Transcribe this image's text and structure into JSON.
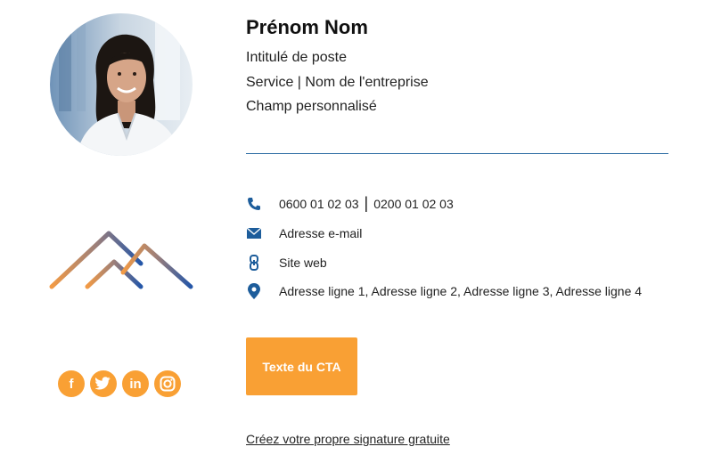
{
  "profile": {
    "name": "Prénom Nom",
    "job_title": "Intitulé de poste",
    "department_company": "Service | Nom de l'entreprise",
    "custom_field": "Champ personnalisé"
  },
  "contacts": {
    "phone_mobile": "0600 01 02 03",
    "phone_separator": "|",
    "phone_landline": "0200 01 02 03",
    "email": "Adresse e-mail",
    "website": "Site web",
    "address": "Adresse ligne 1, Adresse ligne 2, Adresse ligne 3, Adresse ligne 4"
  },
  "cta": {
    "label": "Texte du CTA"
  },
  "social": [
    {
      "icon": "facebook-icon",
      "glyph": "f"
    },
    {
      "icon": "twitter-icon",
      "glyph": ""
    },
    {
      "icon": "linkedin-icon",
      "glyph": "in"
    },
    {
      "icon": "instagram-icon",
      "glyph": ""
    }
  ],
  "footer": {
    "link_label": "Créez votre propre signature gratuite"
  },
  "colors": {
    "accent_orange": "#f9a034",
    "divider_blue": "#2e6da4",
    "icon_blue": "#1d5d9b"
  }
}
